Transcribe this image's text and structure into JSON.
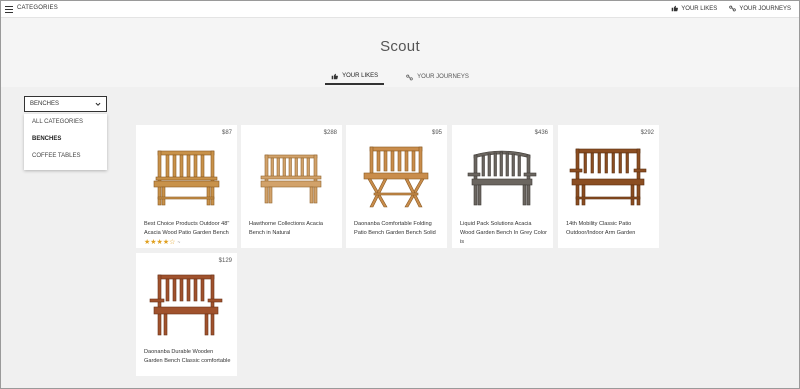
{
  "topbar": {
    "categories_label": "CATEGORIES",
    "your_likes": "YOUR LIKES",
    "your_journeys": "YOUR JOURNEYS"
  },
  "page": {
    "title": "Scout",
    "tabs": [
      {
        "label": "YOUR LIKES",
        "active": true
      },
      {
        "label": "YOUR JOURNEYS",
        "active": false
      }
    ]
  },
  "filter": {
    "selected": "BENCHES",
    "options": [
      "ALL CATEGORIES",
      "BENCHES",
      "COFFEE TABLES"
    ]
  },
  "products": [
    {
      "price": "$87",
      "name": "Best Choice Products Outdoor 48\" Acacia Wood Patio Garden Bench",
      "rating_stars": "★★★★☆",
      "rating_count": "~",
      "rating": 4
    },
    {
      "price": "$288",
      "name": "Hawthorne Collections Acacia Bench in Natural"
    },
    {
      "price": "$95",
      "name": "Daonanba Comfortable Folding Patio Bench Garden Bench Solid"
    },
    {
      "price": "$436",
      "name": "Liquid Pack Solutions Acacia Wood Garden Bench In Grey Color is"
    },
    {
      "price": "$292",
      "name": "14th Mobility Classic Patio Outdoor/Indoor Arm Garden"
    },
    {
      "price": "$129",
      "name": "Daonanba Durable Wooden Garden Bench Classic comfortable"
    }
  ],
  "colors": {
    "accent": "#333333",
    "star": "#e0a020",
    "wood_light": "#c8924a",
    "wood_grey": "#6b6660",
    "wood_red": "#a0522d"
  },
  "icons": {
    "menu": "hamburger-icon",
    "likes": "thumbs-up-icon",
    "journeys": "journey-icon",
    "dropdown": "chevron-down-icon"
  }
}
